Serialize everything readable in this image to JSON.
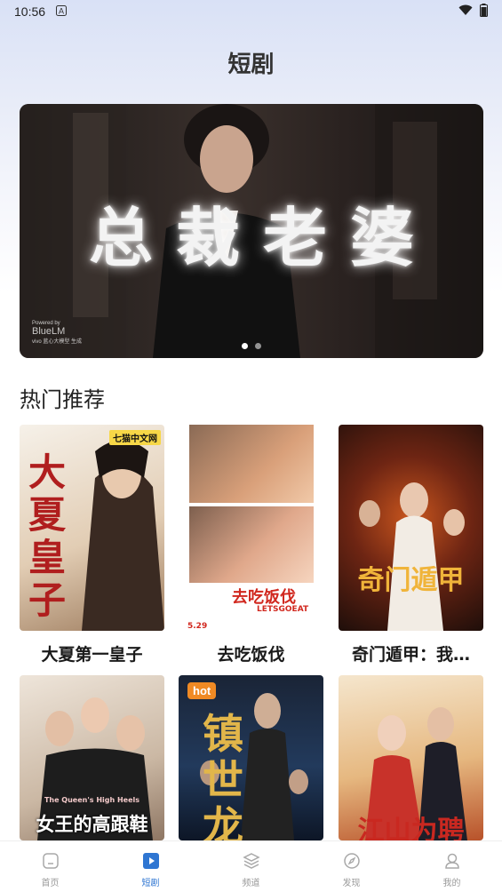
{
  "status_bar": {
    "time": "10:56",
    "notification_icon": "a-notification-icon",
    "wifi_icon": "wifi-icon",
    "battery_icon": "battery-icon"
  },
  "page": {
    "title": "短剧"
  },
  "banner": {
    "title": "总裁老婆",
    "watermark_top": "Powered by",
    "watermark_brand": "BlueLM",
    "watermark_sub": "vivo 蓝心大模型 生成",
    "dot_count": 2,
    "active_dot": 0
  },
  "section": {
    "title": "热门推荐"
  },
  "dramas": [
    {
      "title": "大夏第一皇子",
      "poster_text": "大夏皇子",
      "poster_sub": "七猫中文网",
      "colors": [
        "#f4eee5",
        "#c9a98a"
      ]
    },
    {
      "title": "去吃饭伐",
      "poster_text": "去吃饭伐",
      "poster_sub": "LETSGOEAT",
      "poster_date": "5.29",
      "colors": [
        "#ffffff",
        "#f3e9dc"
      ]
    },
    {
      "title": "奇门遁甲：我…",
      "poster_text": "奇门遁甲",
      "colors": [
        "#2a1410",
        "#c2431c"
      ]
    },
    {
      "title": "",
      "poster_text": "女王的高跟鞋",
      "poster_sub": "The Queen's High Heels",
      "colors": [
        "#e9dfd4",
        "#a5927f"
      ]
    },
    {
      "title": "",
      "poster_text": "镇世龙",
      "badge": "hot",
      "colors": [
        "#0f1a2c",
        "#1d3c6a"
      ]
    },
    {
      "title": "",
      "poster_text": "江山为聘",
      "colors": [
        "#f1d9b6",
        "#d97a3c"
      ]
    }
  ],
  "tabbar": {
    "items": [
      {
        "label": "首页",
        "icon": "home-icon",
        "active": false
      },
      {
        "label": "短剧",
        "icon": "play-icon",
        "active": true
      },
      {
        "label": "频道",
        "icon": "layers-icon",
        "active": false
      },
      {
        "label": "发现",
        "icon": "compass-icon",
        "active": false
      },
      {
        "label": "我的",
        "icon": "user-icon",
        "active": false
      }
    ]
  },
  "colors": {
    "accent": "#2f76d2",
    "hot_badge": "#f08a24"
  }
}
